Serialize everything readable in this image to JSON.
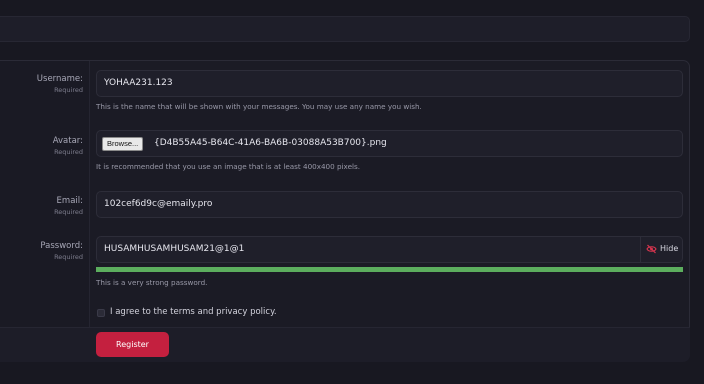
{
  "form": {
    "username": {
      "label": "Username:",
      "required": "Required",
      "value": "YOHAA231.123",
      "hint": "This is the name that will be shown with your messages. You may use any name you wish."
    },
    "avatar": {
      "label": "Avatar:",
      "required": "Required",
      "browse_label": "Browse...",
      "file_name": "{D4B55A45-B64C-41A6-BA6B-03088A53B700}.png",
      "hint": "It is recommended that you use an image that is at least 400x400 pixels."
    },
    "email": {
      "label": "Email:",
      "required": "Required",
      "value": "102cef6d9c@emaily.pro"
    },
    "password": {
      "label": "Password:",
      "required": "Required",
      "value": "HUSAMHUSAMHUSAM21@1@1",
      "hide_label": "Hide",
      "hide_icon": "eye-slash-icon",
      "strength_percent": 100,
      "strength_color": "#5cae5e",
      "strength_text": "This is a very strong password."
    },
    "agree_text": "I agree to the terms and privacy policy.",
    "register_label": "Register",
    "accent_color": "#c4203f"
  }
}
